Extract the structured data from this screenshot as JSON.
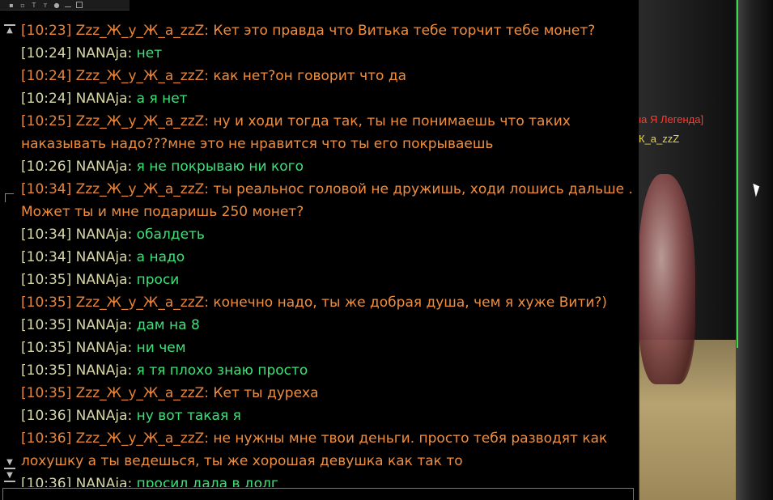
{
  "scene": {
    "nickname_title": "на Я Легенда]",
    "nickname_name": "К_а_zzZ"
  },
  "chat": {
    "messages": [
      {
        "time": "[10:23]",
        "nick": "Zzz_Ж_у_Ж_а_zzZ:",
        "text": "Кет это правда что Витька тебе торчит тебе монет?",
        "who": "zzz"
      },
      {
        "time": "[10:24]",
        "nick": "NANAja:",
        "text": "нет",
        "who": "nana"
      },
      {
        "time": "[10:24]",
        "nick": "Zzz_Ж_у_Ж_а_zzZ:",
        "text": "как нет?он говорит что да",
        "who": "zzz"
      },
      {
        "time": "[10:24]",
        "nick": "NANAja:",
        "text": "а я нет",
        "who": "nana"
      },
      {
        "time": "[10:25]",
        "nick": "Zzz_Ж_у_Ж_а_zzZ:",
        "text": "ну и ходи тогда так, ты не понимаешь что таких наказывать надо???мне это не нравится что ты его покрываешь",
        "who": "zzz"
      },
      {
        "time": "[10:26]",
        "nick": "NANAja:",
        "text": "я не покрываю ни кого",
        "who": "nana"
      },
      {
        "time": "[10:34]",
        "nick": "Zzz_Ж_у_Ж_а_zzZ:",
        "text": "ты реальнос головой не дружишь, ходи лошись дальше . Может ты и мне подаришь 250 монет?",
        "who": "zzz"
      },
      {
        "time": "[10:34]",
        "nick": "NANAja:",
        "text": "обалдеть",
        "who": "nana"
      },
      {
        "time": "[10:34]",
        "nick": "NANAja:",
        "text": "а надо",
        "who": "nana"
      },
      {
        "time": "[10:35]",
        "nick": "NANAja:",
        "text": "проси",
        "who": "nana"
      },
      {
        "time": "[10:35]",
        "nick": "Zzz_Ж_у_Ж_а_zzZ:",
        "text": "конечно надо, ты же добрая душа, чем я  хуже Вити?)",
        "who": "zzz"
      },
      {
        "time": "[10:35]",
        "nick": "NANAja:",
        "text": "дам на 8",
        "who": "nana"
      },
      {
        "time": "[10:35]",
        "nick": "NANAja:",
        "text": "ни чем",
        "who": "nana"
      },
      {
        "time": "[10:35]",
        "nick": "NANAja:",
        "text": "я тя плохо знаю просто",
        "who": "nana"
      },
      {
        "time": "[10:35]",
        "nick": "Zzz_Ж_у_Ж_а_zzZ:",
        "text": "Кет ты дуреха",
        "who": "zzz"
      },
      {
        "time": "[10:36]",
        "nick": "NANAja:",
        "text": "ну вот такая я",
        "who": "nana"
      },
      {
        "time": "[10:36]",
        "nick": "Zzz_Ж_у_Ж_а_zzZ:",
        "text": "не нужны мне твои деньги. просто тебя разводят как лохушку а ты ведешься, ты же хорошая девушка как так то",
        "who": "zzz"
      },
      {
        "time": "[10:36]",
        "nick": "NANAja:",
        "text": "просил дала в долг",
        "who": "nana"
      }
    ]
  }
}
